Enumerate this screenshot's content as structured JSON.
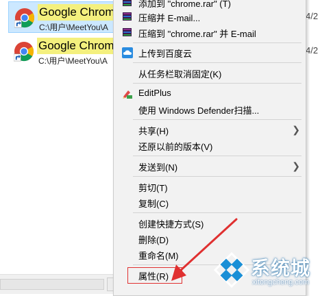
{
  "files": [
    {
      "name": "Google Chrome",
      "path": "C:\\用户\\MeetYou\\A",
      "date_fragment": "4/2"
    },
    {
      "name": "Google Chrome",
      "path": "C:\\用户\\MeetYou\\A",
      "date_fragment": "4/2"
    }
  ],
  "menu": {
    "items": [
      {
        "label": "添加到 \"chrome.rar\" (T)",
        "icon": "winrar-icon"
      },
      {
        "label": "压缩并 E-mail...",
        "icon": "winrar-icon"
      },
      {
        "label": "压缩到 \"chrome.rar\" 并 E-mail",
        "icon": "winrar-icon"
      },
      {
        "label": "上传到百度云",
        "icon": "baidu-cloud-icon"
      },
      {
        "label": "从任务栏取消固定(K)"
      },
      {
        "label": "EditPlus",
        "icon": "editplus-icon"
      },
      {
        "label": "使用 Windows Defender扫描..."
      },
      {
        "label": "共享(H)",
        "submenu": true
      },
      {
        "label": "还原以前的版本(V)"
      },
      {
        "label": "发送到(N)",
        "submenu": true
      },
      {
        "label": "剪切(T)"
      },
      {
        "label": "复制(C)"
      },
      {
        "label": "创建快捷方式(S)"
      },
      {
        "label": "删除(D)"
      },
      {
        "label": "重命名(M)"
      },
      {
        "label": "属性(R)",
        "highlighted": true
      }
    ]
  },
  "watermark": {
    "title": "系统城",
    "url": "xitongcheng.com"
  },
  "colors": {
    "selection_bg": "#cce8ff",
    "name_highlight": "#f4f07e",
    "menu_bg": "#f2f2f2",
    "annotation_red": "#e03030",
    "watermark_blue": "#1a8fd6"
  }
}
